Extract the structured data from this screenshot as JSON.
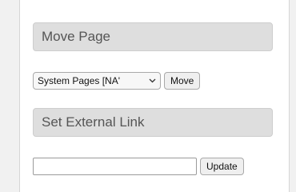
{
  "move_page": {
    "header": "Move Page",
    "selected_option": "System Pages [NA'",
    "button_label": "Move"
  },
  "external_link": {
    "header": "Set External Link",
    "input_value": "",
    "button_label": "Update"
  },
  "icons": {
    "select_arrow": "chevron-down-icon"
  }
}
